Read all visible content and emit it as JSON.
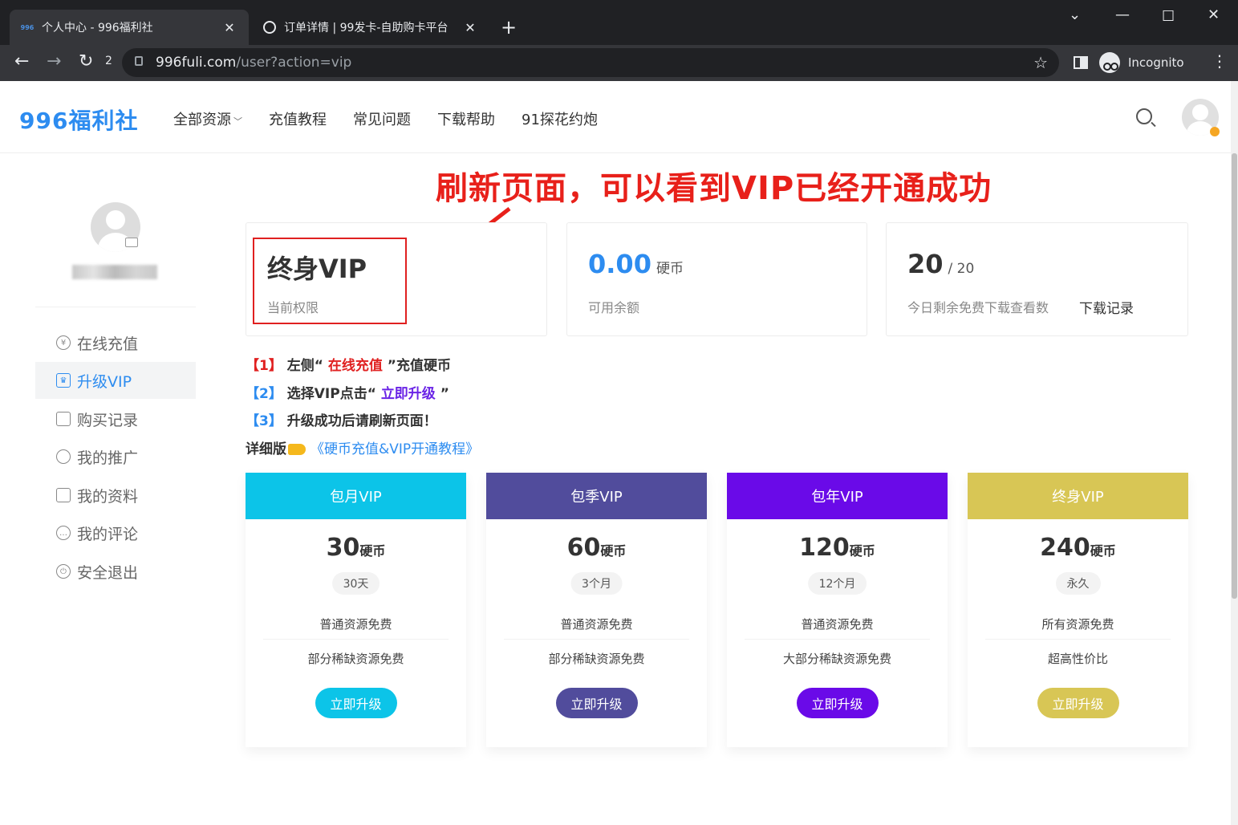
{
  "browser": {
    "tabs": [
      {
        "favicon": "996",
        "title": "个人中心 - 996福利社",
        "active": true
      },
      {
        "title": "订单详情 | 99发卡-自助购卡平台",
        "active": false
      }
    ],
    "reload_count": "2",
    "url_host": "996fuli.com",
    "url_path": "/user?action=vip",
    "incognito_label": "Incognito"
  },
  "site": {
    "logo": "996福利社",
    "nav": [
      "全部资源",
      "充值教程",
      "常见问题",
      "下载帮助",
      "91探花约炮"
    ]
  },
  "annotation": {
    "headline": "刷新页面，可以看到VIP已经开通成功",
    "color": "#e8201a"
  },
  "sidebar": {
    "items": [
      {
        "label": "在线充值",
        "icon": "yen-circle-icon"
      },
      {
        "label": "升级VIP",
        "icon": "crown-icon",
        "active": true
      },
      {
        "label": "购买记录",
        "icon": "bag-icon"
      },
      {
        "label": "我的推广",
        "icon": "share-icon"
      },
      {
        "label": "我的资料",
        "icon": "profile-card-icon"
      },
      {
        "label": "我的评论",
        "icon": "comment-icon"
      },
      {
        "label": "安全退出",
        "icon": "power-icon"
      }
    ]
  },
  "stats": {
    "vip": {
      "value": "终身VIP",
      "label": "当前权限"
    },
    "balance": {
      "value": "0.00",
      "unit": "硬币",
      "label": "可用余额"
    },
    "downloads": {
      "value": "20",
      "total": "/ 20",
      "label": "今日剩余免费下载查看数",
      "link": "下载记录"
    }
  },
  "instructions": {
    "l1": {
      "num": "【1】",
      "a": "左侧“",
      "b": "在线充值",
      "c": "”充值硬币"
    },
    "l2": {
      "num": "【2】",
      "a": "选择VIP点击“",
      "b": "立即升级",
      "c": "”"
    },
    "l3": {
      "num": "【3】",
      "a": "升级成功后请刷新页面！"
    },
    "l4": {
      "a": "详细版",
      "b": "《硬币充值&VIP开通教程》"
    }
  },
  "plans": [
    {
      "name": "包月VIP",
      "price": "30",
      "unit": "硬币",
      "duration": "30天",
      "f1": "普通资源免费",
      "f2": "部分稀缺资源免费",
      "btn": "立即升级",
      "color": "#0cc4e8"
    },
    {
      "name": "包季VIP",
      "price": "60",
      "unit": "硬币",
      "duration": "3个月",
      "f1": "普通资源免费",
      "f2": "部分稀缺资源免费",
      "btn": "立即升级",
      "color": "#514c9c"
    },
    {
      "name": "包年VIP",
      "price": "120",
      "unit": "硬币",
      "duration": "12个月",
      "f1": "普通资源免费",
      "f2": "大部分稀缺资源免费",
      "btn": "立即升级",
      "color": "#6a0ae8"
    },
    {
      "name": "终身VIP",
      "price": "240",
      "unit": "硬币",
      "duration": "永久",
      "f1": "所有资源免费",
      "f2": "超高性价比",
      "btn": "立即升级",
      "color": "#d8c655"
    }
  ]
}
